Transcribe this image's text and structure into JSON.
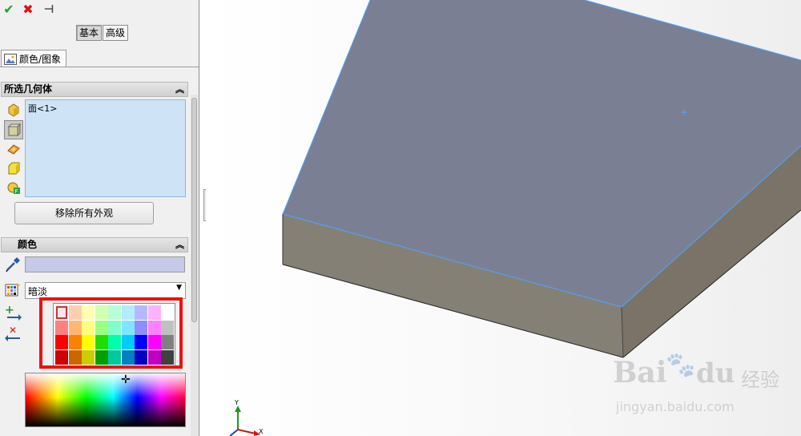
{
  "toolbar": {
    "ok": "✔",
    "cancel": "✖",
    "pin": "⊣"
  },
  "modes": {
    "basic": "基本",
    "advanced": "高级"
  },
  "prop_tab": {
    "label": "颜色/图象"
  },
  "geometry": {
    "title": "所选几何体",
    "collapse": "︽",
    "items": [
      "面<1>"
    ],
    "remove_button": "移除所有外观"
  },
  "color": {
    "title": "颜色",
    "collapse": "︽",
    "current_color": "#c6c9e8",
    "preset": "暗淡",
    "dropdown_arrow": "▼",
    "palette": [
      [
        "#fde6e6",
        "#ffcfb0",
        "#ffffb3",
        "#d3ffb3",
        "#b6ffd7",
        "#b3ecff",
        "#b6b8ff",
        "#ffb3ff",
        "#ffffff"
      ],
      [
        "#ff8080",
        "#ffb870",
        "#ffff80",
        "#9cff80",
        "#80ffcc",
        "#80e6ff",
        "#8b8fff",
        "#ff80ff",
        "#c0c0c0"
      ],
      [
        "#ff0000",
        "#ff8000",
        "#ffff00",
        "#22dd00",
        "#00ffaa",
        "#00ccff",
        "#0000ff",
        "#ff00ff",
        "#808080"
      ],
      [
        "#cc0000",
        "#cc6600",
        "#cccc00",
        "#00a000",
        "#00c8a0",
        "#0080c0",
        "#0000c0",
        "#c000c0",
        "#404040"
      ]
    ]
  },
  "axes": {
    "x": "X",
    "y": "Y"
  },
  "watermark": {
    "brand": "Bai",
    "sub": "jingyan.baidu.com",
    "cn": "经验"
  },
  "colors": {
    "model_top": "#7b7f94",
    "model_front": "#858076",
    "model_side": "#7b7367",
    "edge": "#4da6ff",
    "highlight": "#e11111"
  }
}
